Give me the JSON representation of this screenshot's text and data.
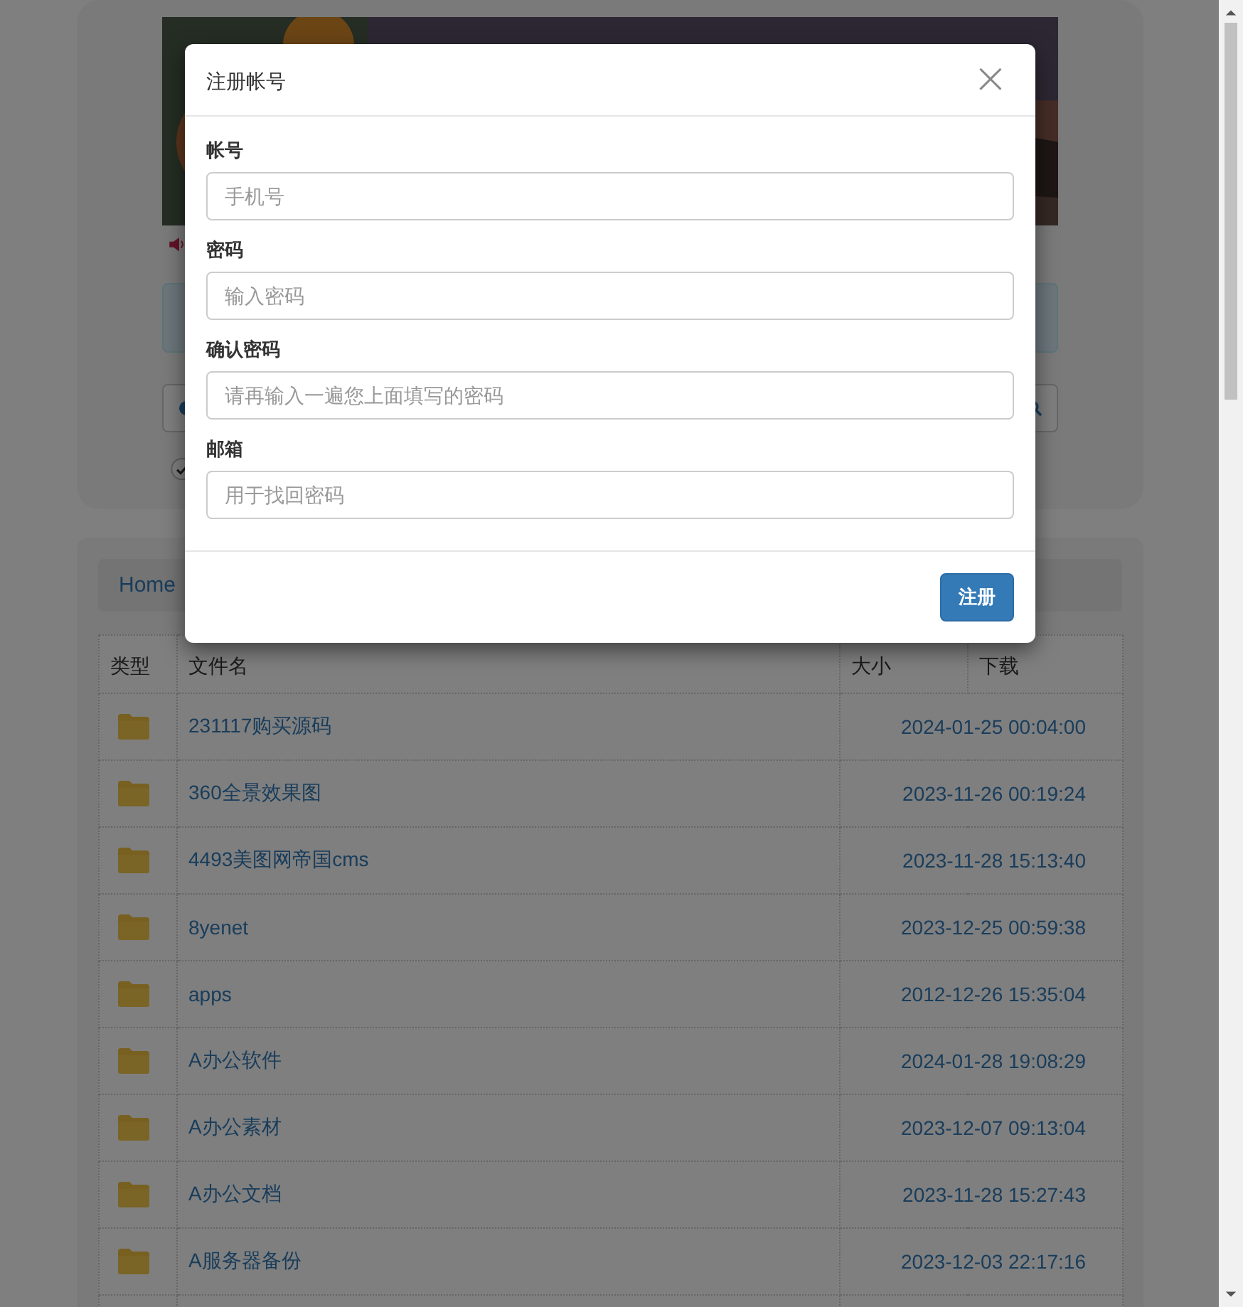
{
  "option": {
    "checked": true
  },
  "breadcrumb": [
    "Home"
  ],
  "table": {
    "columns": [
      "类型",
      "文件名",
      "大小",
      "下载"
    ],
    "rows": [
      {
        "kind": "folder",
        "name": "231117购买源码",
        "date": "2024-01-25 00:04:00"
      },
      {
        "kind": "folder",
        "name": "360全景效果图",
        "date": "2023-11-26 00:19:24"
      },
      {
        "kind": "folder",
        "name": "4493美图网帝国cms",
        "date": "2023-11-28 15:13:40"
      },
      {
        "kind": "folder",
        "name": "8yenet",
        "date": "2023-12-25 00:59:38"
      },
      {
        "kind": "folder",
        "name": "apps",
        "date": "2012-12-26 15:35:04"
      },
      {
        "kind": "folder",
        "name": "A办公软件",
        "date": "2024-01-28 19:08:29"
      },
      {
        "kind": "folder",
        "name": "A办公素材",
        "date": "2023-12-07 09:13:04"
      },
      {
        "kind": "folder",
        "name": "A办公文档",
        "date": "2023-11-28 15:27:43"
      },
      {
        "kind": "folder",
        "name": "A服务器备份",
        "date": "2023-12-03 22:17:16"
      }
    ]
  },
  "modal": {
    "title": "注册帐号",
    "close": "×",
    "fields": [
      {
        "label": "帐号",
        "placeholder": "手机号"
      },
      {
        "label": "密码",
        "placeholder": "输入密码"
      },
      {
        "label": "确认密码",
        "placeholder": "请再输入一遍您上面填写的密码"
      },
      {
        "label": "邮箱",
        "placeholder": "用于找回密码"
      }
    ],
    "submit": "注册"
  }
}
